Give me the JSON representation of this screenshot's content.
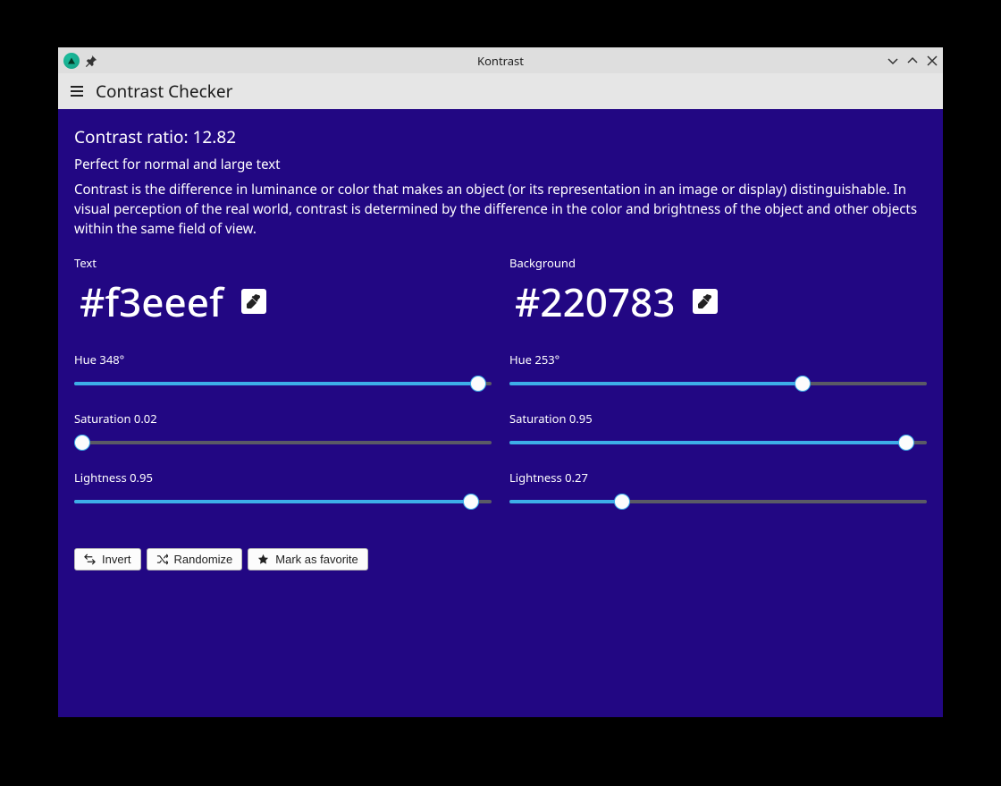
{
  "window": {
    "title": "Kontrast"
  },
  "header": {
    "title": "Contrast Checker"
  },
  "main": {
    "ratio_label": "Contrast ratio: 12.82",
    "rating": "Perfect for normal and large text",
    "description": "Contrast is the difference in luminance or color that makes an object (or its representation in an image or display) distinguishable. In visual perception of the real world, contrast is determined by the difference in the color and brightness of the object and other objects within the same field of view."
  },
  "text_color": {
    "label": "Text",
    "value": "#f3eeef",
    "hue": {
      "label": "Hue 348°",
      "pct": 96.7
    },
    "saturation": {
      "label": "Saturation 0.02",
      "pct": 2
    },
    "lightness": {
      "label": "Lightness 0.95",
      "pct": 95
    }
  },
  "bg_color": {
    "label": "Background",
    "value": "#220783",
    "hue": {
      "label": "Hue 253°",
      "pct": 70.3
    },
    "saturation": {
      "label": "Saturation 0.95",
      "pct": 95
    },
    "lightness": {
      "label": "Lightness 0.27",
      "pct": 27
    }
  },
  "actions": {
    "invert": "Invert",
    "randomize": "Randomize",
    "favorite": "Mark as favorite"
  }
}
